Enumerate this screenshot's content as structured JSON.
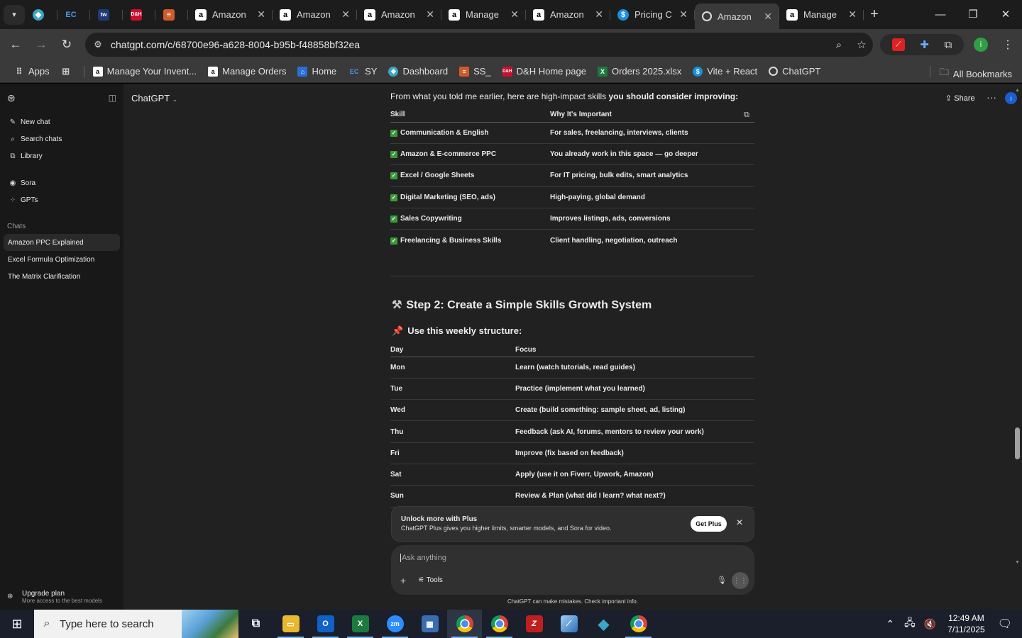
{
  "browser": {
    "tabs": [
      {
        "title": "",
        "icon": "app-icon"
      },
      {
        "title": "",
        "icon": "ec-icon"
      },
      {
        "title": "",
        "icon": "tw-icon"
      },
      {
        "title": "",
        "icon": "red-app-icon"
      },
      {
        "title": "",
        "icon": "stack-icon"
      },
      {
        "title": "Amazon",
        "icon": "amazon-icon"
      },
      {
        "title": "Amazon",
        "icon": "amazon-icon"
      },
      {
        "title": "Amazon",
        "icon": "amazon-icon"
      },
      {
        "title": "Manage",
        "icon": "amazon-icon"
      },
      {
        "title": "Amazon",
        "icon": "amazon-icon"
      },
      {
        "title": "Pricing C",
        "icon": "dollar-icon"
      },
      {
        "title": "Amazon",
        "icon": "chatgpt-icon"
      },
      {
        "title": "Manage",
        "icon": "amazon-icon"
      }
    ],
    "url": "chatgpt.com/c/68700e96-a628-8004-b95b-f48858bf32ea",
    "bookmarks": [
      {
        "label": "Apps"
      },
      {
        "label": ""
      },
      {
        "label": "Manage Your Invent..."
      },
      {
        "label": "Manage Orders"
      },
      {
        "label": "Home"
      },
      {
        "label": "SY"
      },
      {
        "label": "Dashboard"
      },
      {
        "label": "SS_"
      },
      {
        "label": "D&H Home page"
      },
      {
        "label": "Orders 2025.xlsx"
      },
      {
        "label": "Vite + React"
      },
      {
        "label": "ChatGPT"
      }
    ],
    "all_bookmarks": "All Bookmarks"
  },
  "sidebar": {
    "nav": [
      {
        "label": "New chat"
      },
      {
        "label": "Search chats"
      },
      {
        "label": "Library"
      }
    ],
    "nav2": [
      {
        "label": "Sora"
      },
      {
        "label": "GPTs"
      }
    ],
    "chats_header": "Chats",
    "chats": [
      {
        "label": "Amazon PPC Explained"
      },
      {
        "label": "Excel Formula Optimization"
      },
      {
        "label": "The Matrix Clarification"
      }
    ],
    "upgrade_title": "Upgrade plan",
    "upgrade_sub": "More access to the best models"
  },
  "header": {
    "model": "ChatGPT",
    "share": "Share",
    "avatar_initial": "i"
  },
  "message": {
    "intro_plain": "From what you told me earlier, here are high-impact skills ",
    "intro_bold": "you should consider improving:",
    "skills_table": {
      "headers": [
        "Skill",
        "Why It's Important"
      ],
      "rows": [
        [
          "Communication & English",
          "For sales, freelancing, interviews, clients"
        ],
        [
          "Amazon & E-commerce PPC",
          "You already work in this space — go deeper"
        ],
        [
          "Excel / Google Sheets",
          "For IT pricing, bulk edits, smart analytics"
        ],
        [
          "Digital Marketing (SEO, ads)",
          "High-paying, global demand"
        ],
        [
          "Sales Copywriting",
          "Improves listings, ads, conversions"
        ],
        [
          "Freelancing & Business Skills",
          "Client handling, negotiation, outreach"
        ]
      ]
    },
    "step2_title": "Step 2: Create a Simple Skills Growth System",
    "weekly_title": "Use this weekly structure:",
    "weekly_table": {
      "headers": [
        "Day",
        "Focus"
      ],
      "rows": [
        [
          "Mon",
          "Learn (watch tutorials, read guides)"
        ],
        [
          "Tue",
          "Practice (implement what you learned)"
        ],
        [
          "Wed",
          "Create (build something: sample sheet, ad, listing)"
        ],
        [
          "Thu",
          "Feedback (ask AI, forums, mentors to review your work)"
        ],
        [
          "Fri",
          "Improve (fix based on feedback)"
        ],
        [
          "Sat",
          "Apply (use it on Fiverr, Upwork, Amazon)"
        ],
        [
          "Sun",
          "Review & Plan (what did I learn? what next?)"
        ]
      ]
    }
  },
  "upsell": {
    "title": "Unlock more with Plus",
    "subtitle": "ChatGPT Plus gives you higher limits, smarter models, and Sora for video.",
    "button": "Get Plus"
  },
  "composer": {
    "placeholder": "Ask anything",
    "tools": "Tools"
  },
  "disclaimer": "ChatGPT can make mistakes. Check important info.",
  "taskbar": {
    "search_placeholder": "Type here to search",
    "time": "12:49 AM",
    "date": "7/11/2025"
  }
}
